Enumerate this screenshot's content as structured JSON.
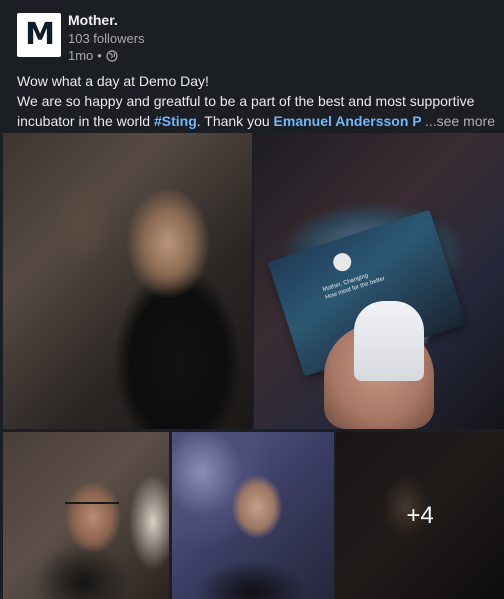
{
  "post": {
    "company": {
      "logo_letter": "M",
      "name": "Mother.",
      "followers": "103 followers",
      "time": "1mo",
      "separator": "•",
      "visibility_icon": "globe-icon"
    },
    "text": {
      "line1": "Wow what a day at Demo Day!",
      "line2": "We are so happy and greatful to be a part of the best and most supportive",
      "line3_prefix": "incubator in the world ",
      "hashtag": "#Sting",
      "line3_mid": ". Thank you ",
      "mentions": "Emanuel Andersson Pär Hö",
      "see_more": "...see more"
    },
    "photos": {
      "card_title": "Mother. Changing",
      "card_subtitle": "How mind for the better",
      "more_count": "+4"
    }
  },
  "colors": {
    "background": "#1b1f23",
    "link": "#71b7fb",
    "muted": "#a8a8a8"
  }
}
